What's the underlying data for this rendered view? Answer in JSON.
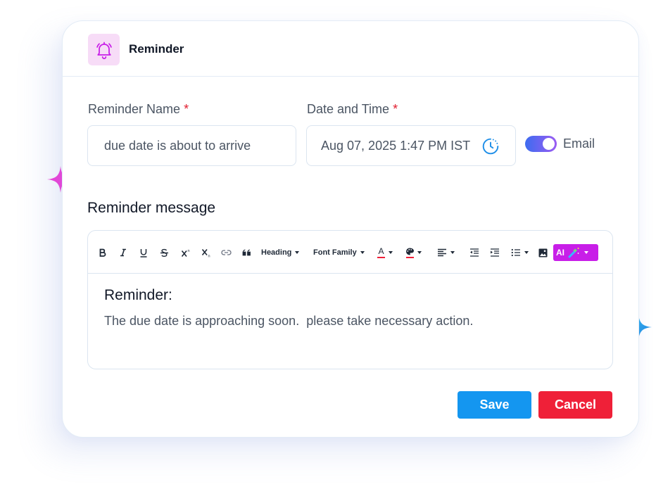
{
  "header": {
    "title": "Reminder",
    "icon": "bell-icon"
  },
  "form": {
    "name_label": "Reminder Name",
    "name_value": "due date is about to arrive",
    "date_label": "Date and Time",
    "date_value": "Aug 07, 2025 1:47 PM IST",
    "required_mark": "*",
    "email_toggle_label": "Email",
    "email_toggle_on": true
  },
  "message": {
    "section_title": "Reminder message",
    "toolbar": {
      "heading": "Heading",
      "font_family": "Font Family",
      "ai": "AI",
      "font_color_letter": "A"
    },
    "content_heading": "Reminder:",
    "content_body": "The due date is approaching soon.  please take necessary action."
  },
  "actions": {
    "save": "Save",
    "cancel": "Cancel"
  },
  "colors": {
    "accent_blue": "#1496f0",
    "danger_red": "#ef2038",
    "ai_magenta": "#c81ee8",
    "bell_bg": "#f7dcf7",
    "sparkle_pink": "#f43dd8",
    "sparkle_blue": "#2aa8f0"
  }
}
